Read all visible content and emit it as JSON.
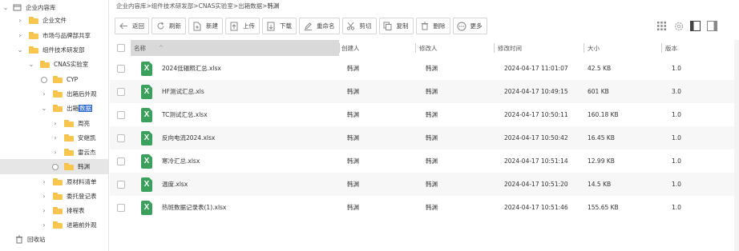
{
  "sidebar": {
    "root": "企业内容库",
    "items": [
      {
        "label": "企业文件"
      },
      {
        "label": "市场与品牌部共享"
      },
      {
        "label": "组件技术研发部"
      },
      {
        "label": "CNAS实验室"
      },
      {
        "label": "CYP"
      },
      {
        "label": "出箱后外观"
      },
      {
        "label_pre": "出箱",
        "label_hl": "数据"
      },
      {
        "label": "周亮"
      },
      {
        "label": "安继凯"
      },
      {
        "label": "雷云杰"
      },
      {
        "label": "韩渊"
      },
      {
        "label": "原材料清单"
      },
      {
        "label": "委托登记表"
      },
      {
        "label": "排程表"
      },
      {
        "label": "进箱前外观"
      }
    ],
    "trash": "回收站"
  },
  "breadcrumb": {
    "parts": [
      "企业内容库",
      "组件技术研发部",
      "CNAS实验室",
      "出箱数据"
    ],
    "current": "韩渊",
    "sep": ">"
  },
  "toolbar": {
    "back": "返回",
    "refresh": "刷新",
    "new": "新建",
    "upload": "上传",
    "download": "下载",
    "rename": "重命名",
    "cut": "剪切",
    "copy": "复制",
    "delete": "删除",
    "more": "更多"
  },
  "table": {
    "headers": {
      "name": "名称",
      "creator": "创建人",
      "modifier": "修改人",
      "modified": "修改时间",
      "size": "大小",
      "version": "版本"
    },
    "file_icon_letter": "X",
    "rows": [
      {
        "name": "2024低辐照汇总.xlsx",
        "creator": "韩渊",
        "modifier": "韩渊",
        "modified": "2024-04-17 11:01:07",
        "size": "42.5 KB",
        "version": "1.0"
      },
      {
        "name": "HF测试汇总.xls",
        "creator": "韩渊",
        "modifier": "韩渊",
        "modified": "2024-04-17 10:49:15",
        "size": "601 KB",
        "version": "3.0"
      },
      {
        "name": "TC测试汇总.xlsx",
        "creator": "韩渊",
        "modifier": "韩渊",
        "modified": "2024-04-17 10:50:11",
        "size": "160.18 KB",
        "version": "1.0"
      },
      {
        "name": "反向电流2024.xlsx",
        "creator": "韩渊",
        "modifier": "韩渊",
        "modified": "2024-04-17 10:50:42",
        "size": "16.45 KB",
        "version": "1.0"
      },
      {
        "name": "寒冷汇总.xlsx",
        "creator": "韩渊",
        "modifier": "韩渊",
        "modified": "2024-04-17 10:51:14",
        "size": "12.99 KB",
        "version": "1.0"
      },
      {
        "name": "温度.xlsx",
        "creator": "韩渊",
        "modifier": "韩渊",
        "modified": "2024-04-17 10:51:20",
        "size": "14.5 KB",
        "version": "1.0"
      },
      {
        "name": "热斑数据记录表(1).xlsx",
        "creator": "韩渊",
        "modifier": "韩渊",
        "modified": "2024-04-17 10:51:46",
        "size": "155.65 KB",
        "version": "1.0"
      }
    ]
  },
  "colors": {
    "folder": "#f8c64f",
    "excel": "#3aa05c",
    "selection_highlight": "#2f6bd1",
    "selected_row_bg": "#e6e6e6"
  }
}
